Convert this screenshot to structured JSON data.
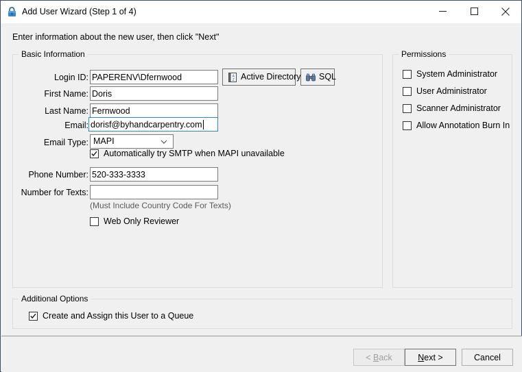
{
  "window": {
    "title": "Add User Wizard (Step 1 of 4)",
    "icon": "lock-icon",
    "controls": {
      "minimize": "minimize-icon",
      "maximize": "maximize-icon",
      "close": "close-icon"
    }
  },
  "prompt": "Enter information about the new user, then click \"Next\"",
  "groups": {
    "basic": {
      "title": "Basic Information"
    },
    "permissions": {
      "title": "Permissions"
    },
    "additional": {
      "title": "Additional Options"
    }
  },
  "fields": {
    "login_id": {
      "label": "Login ID:",
      "value": "PAPERENV\\Dfernwood",
      "placeholder": "",
      "focused": false
    },
    "first_name": {
      "label": "First Name:",
      "value": "Doris",
      "placeholder": "",
      "focused": false
    },
    "last_name": {
      "label": "Last Name:",
      "value": "Fernwood",
      "placeholder": "",
      "focused": false
    },
    "email": {
      "label": "Email:",
      "value": "dorisf@byhandcarpentry.com",
      "placeholder": "",
      "focused": true
    },
    "email_type": {
      "label": "Email Type:",
      "value": "MAPI",
      "options": [
        "MAPI",
        "SMTP"
      ]
    },
    "phone_number": {
      "label": "Phone Number:",
      "value": "520-333-3333",
      "placeholder": "",
      "focused": false
    },
    "number_for_texts": {
      "label": "Number for Texts:",
      "value": "",
      "placeholder": "",
      "focused": false
    },
    "texts_note": "(Must Include Country Code For Texts)"
  },
  "lookup_buttons": {
    "active_directory": {
      "label": "Active Directory",
      "icon": "address-book-icon"
    },
    "sql": {
      "label": "SQL",
      "icon": "binoculars-icon"
    }
  },
  "checkboxes": {
    "smtp_fallback": {
      "label": "Automatically try SMTP when MAPI unavailable",
      "checked": true
    },
    "web_only_reviewer": {
      "label": "Web Only Reviewer",
      "checked": false
    },
    "create_assign_queue": {
      "label": "Create and Assign this User to a Queue",
      "checked": true
    }
  },
  "permissions": [
    {
      "label": "System Administrator",
      "checked": false
    },
    {
      "label": "User Administrator",
      "checked": false
    },
    {
      "label": "Scanner Administrator",
      "checked": false
    },
    {
      "label": "Allow Annotation Burn In",
      "checked": false
    }
  ],
  "footer": {
    "back": {
      "label": "< Back",
      "accel": "B",
      "disabled": true
    },
    "next": {
      "label": "Next >",
      "accel": "N",
      "default": true
    },
    "cancel": {
      "label": "Cancel",
      "accel": "",
      "disabled": false
    }
  },
  "colors": {
    "window_border": "#3c5064",
    "body": "#f0f0f0",
    "titlebar": "#ffffff",
    "field_border": "#7a7a7a",
    "focus_border": "#2a8cd6",
    "group_border": "#dcdcdc",
    "note_text": "#5a5a5a",
    "disabled_text": "#a0a0a0"
  }
}
